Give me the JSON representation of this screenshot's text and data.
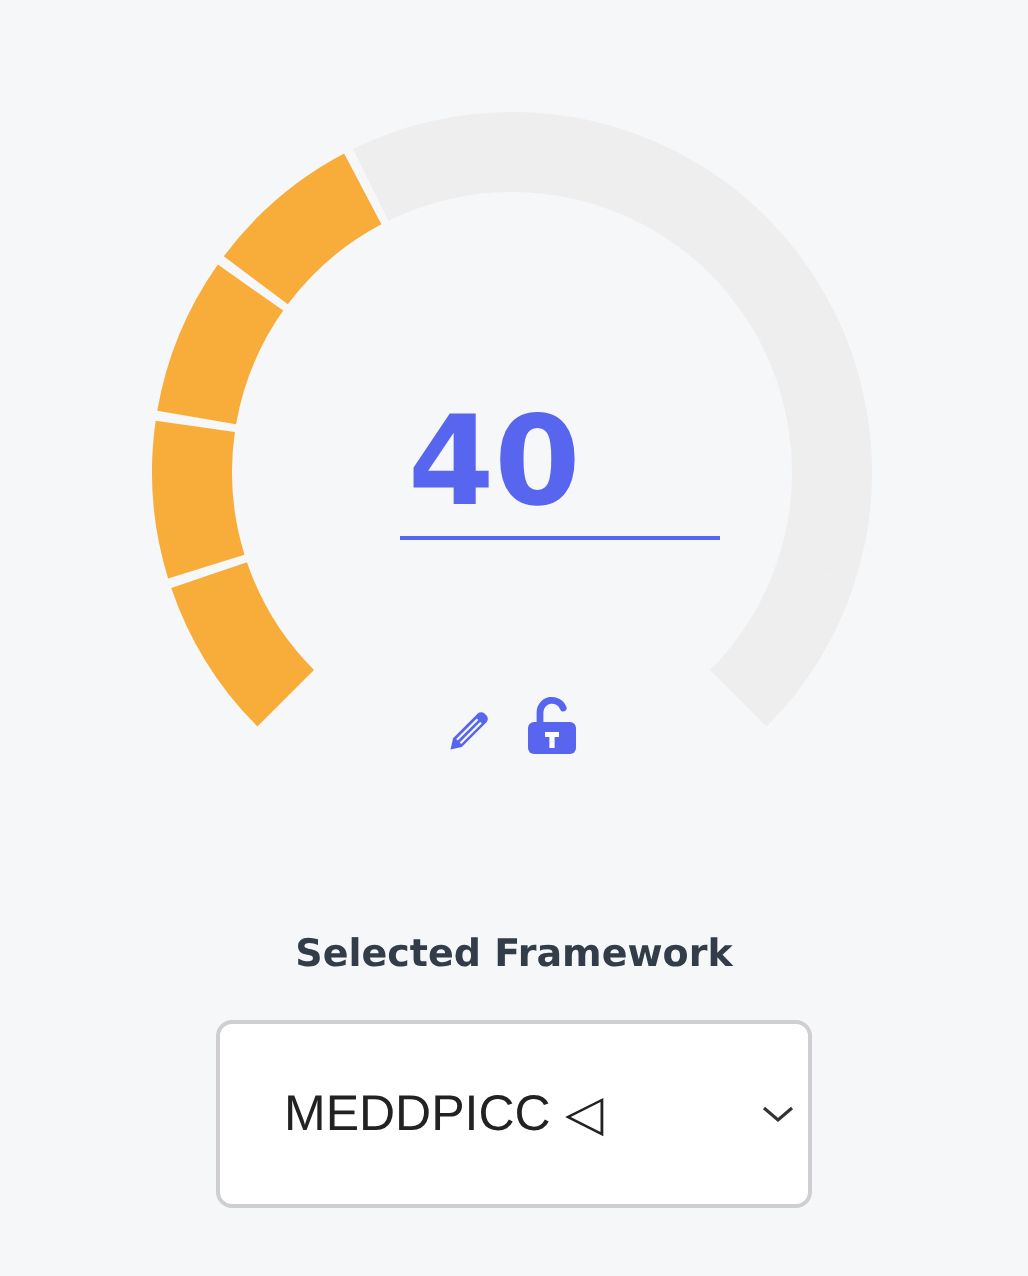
{
  "gauge": {
    "value": "40",
    "segments": [
      {
        "filled": true
      },
      {
        "filled": true
      },
      {
        "filled": true
      },
      {
        "filled": true
      },
      {
        "filled": false
      },
      {
        "filled": false
      },
      {
        "filled": false
      },
      {
        "filled": false
      },
      {
        "filled": false
      },
      {
        "filled": false
      }
    ]
  },
  "framework": {
    "label": "Selected Framework",
    "value": "MEDDPICC ◁"
  }
}
